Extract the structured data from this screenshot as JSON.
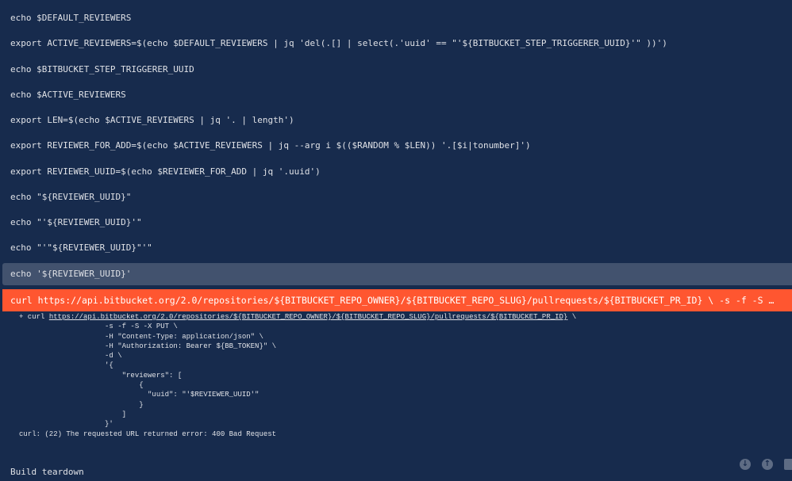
{
  "log": {
    "commands": [
      "echo $DEFAULT_REVIEWERS",
      "export ACTIVE_REVIEWERS=$(echo $DEFAULT_REVIEWERS | jq 'del(.[] | select(.'uuid' == \"'${BITBUCKET_STEP_TRIGGERER_UUID}'\" ))')",
      "echo $BITBUCKET_STEP_TRIGGERER_UUID",
      "echo $ACTIVE_REVIEWERS",
      "export LEN=$(echo $ACTIVE_REVIEWERS | jq '. | length')",
      "export REVIEWER_FOR_ADD=$(echo $ACTIVE_REVIEWERS | jq --arg i $(($RANDOM % $LEN)) '.[$i|tonumber]')",
      "export REVIEWER_UUID=$(echo $REVIEWER_FOR_ADD | jq '.uuid')",
      "echo \"${REVIEWER_UUID}\"",
      "echo \"'${REVIEWER_UUID}'\"",
      "echo \"'\"${REVIEWER_UUID}\"'\"",
      "echo '${REVIEWER_UUID}'"
    ],
    "failed_command": "curl https://api.bitbucket.org/2.0/repositories/${BITBUCKET_REPO_OWNER}/${BITBUCKET_REPO_SLUG}/pullrequests/${BITBUCKET_PR_ID} \\ -s -f -S -X PUT \\ -H \"Content-Type: application/json\" \\ -H \"Authorization: Bearer ${BB_TOKEN}\" \\ -d",
    "output": {
      "prefix": "+ curl ",
      "url": "https://api.bitbucket.org/2.0/repositories/${BITBUCKET_REPO_OWNER}/${BITBUCKET_REPO_SLUG}/pullrequests/${BITBUCKET_PR_ID}",
      "url_suffix": " \\",
      "lines": [
        "                    -s -f -S -X PUT \\",
        "                    -H \"Content-Type: application/json\" \\",
        "                    -H \"Authorization: Bearer ${BB_TOKEN}\" \\",
        "                    -d \\",
        "                    '{",
        "                        \"reviewers\": [",
        "                            {",
        "                              \"uuid\": \"'$REVIEWER_UUID'\"",
        "                            }",
        "                        ]",
        "                    }'",
        "curl: (22) The requested URL returned error: 400 Bad Request"
      ]
    },
    "teardown": "Build teardown"
  },
  "controls": {
    "scroll_down_icon": "↓",
    "scroll_up_icon": "↑"
  },
  "colors": {
    "background": "#172b4d",
    "selected_row": "#42526e",
    "error_row": "#ff5630",
    "text": "#dfe1e6"
  }
}
